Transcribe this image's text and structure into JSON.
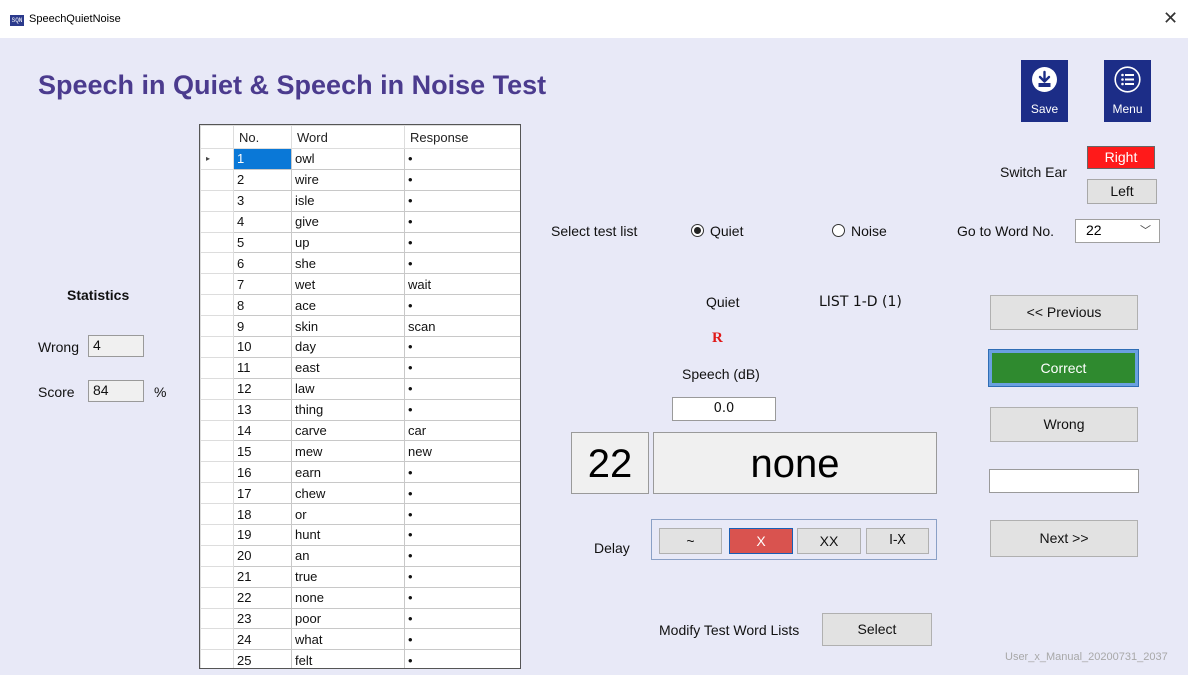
{
  "window": {
    "title": "SpeechQuietNoise",
    "icon_text": "SQN",
    "close_glyph": "✕"
  },
  "header": {
    "title": "Speech in Quiet & Speech in Noise Test"
  },
  "toolbar": {
    "save_label": "Save",
    "menu_label": "Menu"
  },
  "grid": {
    "columns": [
      "No.",
      "Word",
      "Response"
    ],
    "current_row_marker": "▸",
    "rows": [
      {
        "no": "1",
        "word": "owl",
        "response": "•"
      },
      {
        "no": "2",
        "word": "wire",
        "response": "•"
      },
      {
        "no": "3",
        "word": "isle",
        "response": "•"
      },
      {
        "no": "4",
        "word": "give",
        "response": "•"
      },
      {
        "no": "5",
        "word": "up",
        "response": "•"
      },
      {
        "no": "6",
        "word": "she",
        "response": "•"
      },
      {
        "no": "7",
        "word": "wet",
        "response": "wait"
      },
      {
        "no": "8",
        "word": "ace",
        "response": "•"
      },
      {
        "no": "9",
        "word": "skin",
        "response": "scan"
      },
      {
        "no": "10",
        "word": "day",
        "response": "•"
      },
      {
        "no": "11",
        "word": "east",
        "response": "•"
      },
      {
        "no": "12",
        "word": "law",
        "response": "•"
      },
      {
        "no": "13",
        "word": "thing",
        "response": "•"
      },
      {
        "no": "14",
        "word": "carve",
        "response": "car"
      },
      {
        "no": "15",
        "word": "mew",
        "response": "new"
      },
      {
        "no": "16",
        "word": "earn",
        "response": "•"
      },
      {
        "no": "17",
        "word": "chew",
        "response": "•"
      },
      {
        "no": "18",
        "word": "or",
        "response": "•"
      },
      {
        "no": "19",
        "word": "hunt",
        "response": "•"
      },
      {
        "no": "20",
        "word": "an",
        "response": "•"
      },
      {
        "no": "21",
        "word": "true",
        "response": "•"
      },
      {
        "no": "22",
        "word": "none",
        "response": "•"
      },
      {
        "no": "23",
        "word": "poor",
        "response": "•"
      },
      {
        "no": "24",
        "word": "what",
        "response": "•"
      },
      {
        "no": "25",
        "word": "felt",
        "response": "•"
      }
    ]
  },
  "statistics": {
    "title": "Statistics",
    "wrong_label": "Wrong",
    "wrong_value": "4",
    "score_label": "Score",
    "score_value": "84",
    "score_unit": "%"
  },
  "test_list": {
    "label": "Select test list",
    "options": [
      "Quiet",
      "Noise"
    ],
    "selected": "Quiet"
  },
  "status": {
    "mode": "Quiet",
    "list": "LIST 1-D (1)",
    "ear_indicator": "R"
  },
  "speech": {
    "label": "Speech (dB)",
    "value": "0.0"
  },
  "current": {
    "number": "22",
    "word": "none"
  },
  "delay": {
    "label": "Delay",
    "options": [
      "~",
      "X",
      "XX",
      "I-X"
    ],
    "selected": "X"
  },
  "modify": {
    "label": "Modify Test Word Lists",
    "button": "Select"
  },
  "ear": {
    "label": "Switch Ear",
    "right": "Right",
    "left": "Left",
    "selected": "Right"
  },
  "goto": {
    "label": "Go to Word No.",
    "value": "22"
  },
  "nav": {
    "previous": "<< Previous",
    "correct": "Correct",
    "wrong": "Wrong",
    "response_input": "",
    "next": "Next >>"
  },
  "footer": {
    "text": "User_x_Manual_20200731_2037"
  },
  "colors": {
    "accent_title": "#4b3b8e",
    "toolbar_btn": "#1c2d87",
    "correct_green": "#2f8a2f",
    "right_red": "#ff1a1a",
    "delay_selected": "#d9534f",
    "selection_blue": "#0a78d7"
  }
}
